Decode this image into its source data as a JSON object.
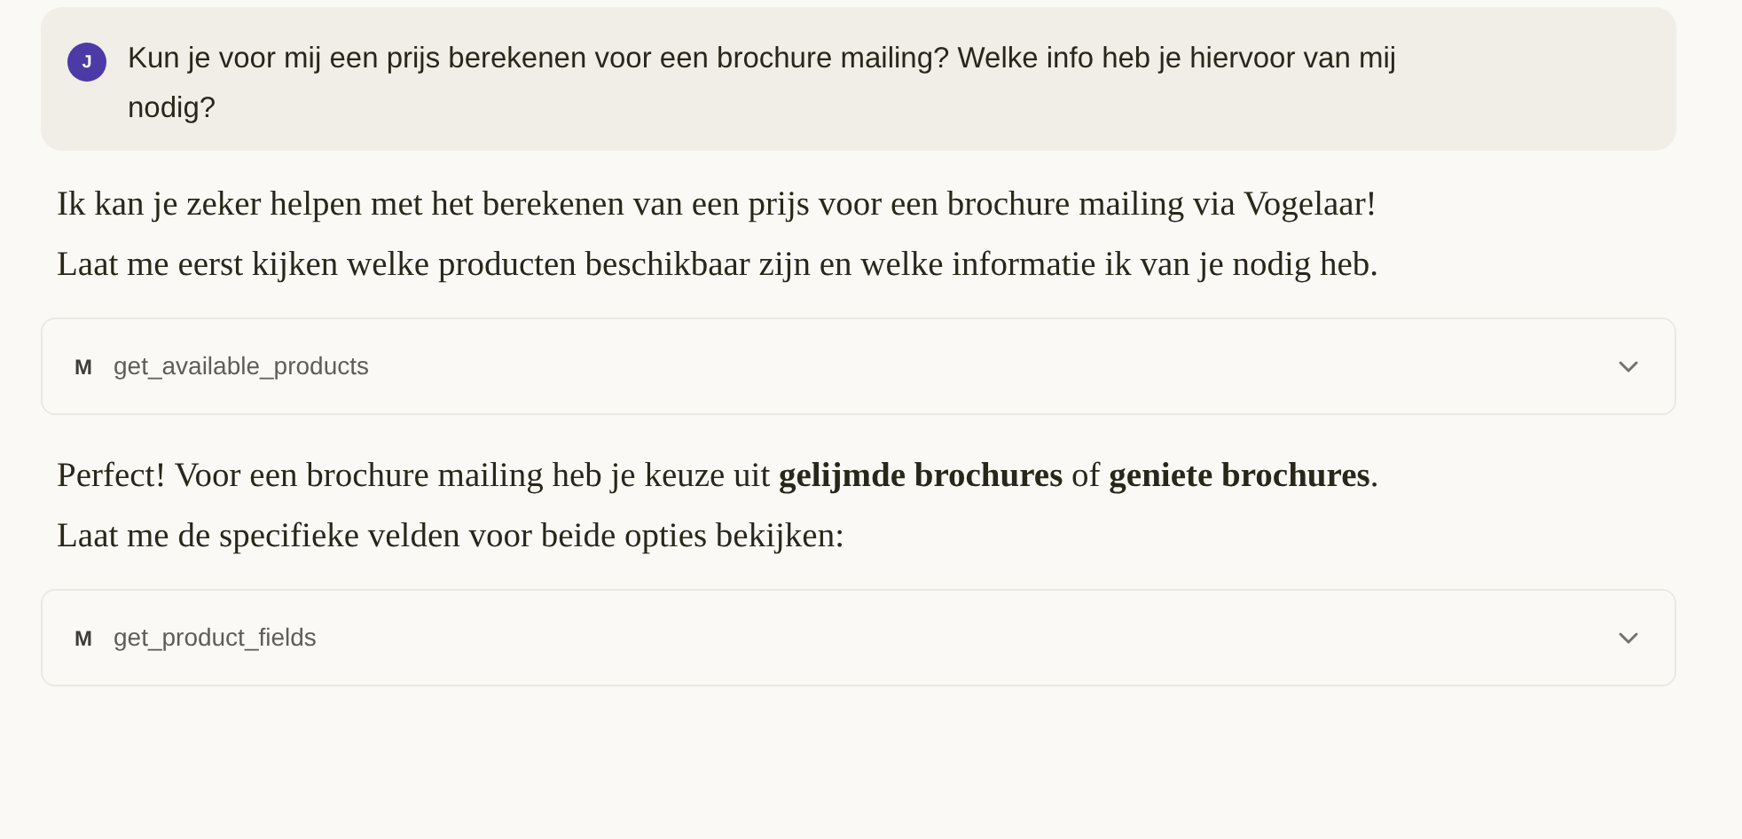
{
  "user_message": {
    "avatar": "J",
    "text": "Kun je voor mij een prijs berekenen voor een brochure mailing? Welke info heb je hiervoor van mij nodig?"
  },
  "assistant_items": [
    {
      "kind": "text",
      "text": "Ik kan je zeker helpen met het berekenen van een prijs voor een brochure mailing via Vogelaar! Laat me eerst kijken welke producten beschikbaar zijn en welke informatie ik van je nodig heb."
    },
    {
      "kind": "tool",
      "badge": "M",
      "name": "get_available_products",
      "expanded": false
    },
    {
      "kind": "text",
      "text": "Perfect! Voor een brochure mailing heb je keuze uit **gelijmde brochures** of **geniete brochures**. Laat me de specifieke velden voor beide opties bekijken:"
    },
    {
      "kind": "tool",
      "badge": "M",
      "name": "get_product_fields",
      "expanded": false
    }
  ]
}
